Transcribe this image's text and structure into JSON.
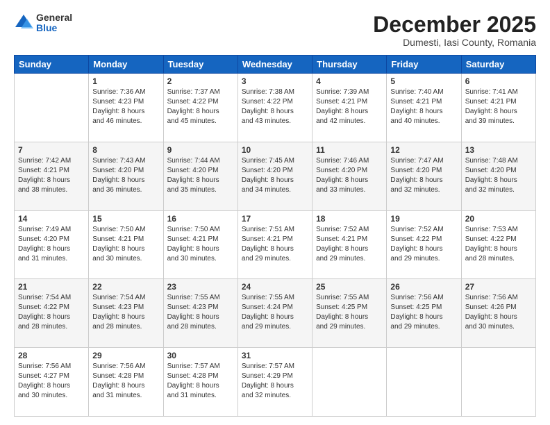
{
  "header": {
    "logo_general": "General",
    "logo_blue": "Blue",
    "month_title": "December 2025",
    "location": "Dumesti, Iasi County, Romania"
  },
  "days_of_week": [
    "Sunday",
    "Monday",
    "Tuesday",
    "Wednesday",
    "Thursday",
    "Friday",
    "Saturday"
  ],
  "weeks": [
    [
      {
        "day": "",
        "info": ""
      },
      {
        "day": "1",
        "info": "Sunrise: 7:36 AM\nSunset: 4:23 PM\nDaylight: 8 hours\nand 46 minutes."
      },
      {
        "day": "2",
        "info": "Sunrise: 7:37 AM\nSunset: 4:22 PM\nDaylight: 8 hours\nand 45 minutes."
      },
      {
        "day": "3",
        "info": "Sunrise: 7:38 AM\nSunset: 4:22 PM\nDaylight: 8 hours\nand 43 minutes."
      },
      {
        "day": "4",
        "info": "Sunrise: 7:39 AM\nSunset: 4:21 PM\nDaylight: 8 hours\nand 42 minutes."
      },
      {
        "day": "5",
        "info": "Sunrise: 7:40 AM\nSunset: 4:21 PM\nDaylight: 8 hours\nand 40 minutes."
      },
      {
        "day": "6",
        "info": "Sunrise: 7:41 AM\nSunset: 4:21 PM\nDaylight: 8 hours\nand 39 minutes."
      }
    ],
    [
      {
        "day": "7",
        "info": "Sunrise: 7:42 AM\nSunset: 4:21 PM\nDaylight: 8 hours\nand 38 minutes."
      },
      {
        "day": "8",
        "info": "Sunrise: 7:43 AM\nSunset: 4:20 PM\nDaylight: 8 hours\nand 36 minutes."
      },
      {
        "day": "9",
        "info": "Sunrise: 7:44 AM\nSunset: 4:20 PM\nDaylight: 8 hours\nand 35 minutes."
      },
      {
        "day": "10",
        "info": "Sunrise: 7:45 AM\nSunset: 4:20 PM\nDaylight: 8 hours\nand 34 minutes."
      },
      {
        "day": "11",
        "info": "Sunrise: 7:46 AM\nSunset: 4:20 PM\nDaylight: 8 hours\nand 33 minutes."
      },
      {
        "day": "12",
        "info": "Sunrise: 7:47 AM\nSunset: 4:20 PM\nDaylight: 8 hours\nand 32 minutes."
      },
      {
        "day": "13",
        "info": "Sunrise: 7:48 AM\nSunset: 4:20 PM\nDaylight: 8 hours\nand 32 minutes."
      }
    ],
    [
      {
        "day": "14",
        "info": "Sunrise: 7:49 AM\nSunset: 4:20 PM\nDaylight: 8 hours\nand 31 minutes."
      },
      {
        "day": "15",
        "info": "Sunrise: 7:50 AM\nSunset: 4:21 PM\nDaylight: 8 hours\nand 30 minutes."
      },
      {
        "day": "16",
        "info": "Sunrise: 7:50 AM\nSunset: 4:21 PM\nDaylight: 8 hours\nand 30 minutes."
      },
      {
        "day": "17",
        "info": "Sunrise: 7:51 AM\nSunset: 4:21 PM\nDaylight: 8 hours\nand 29 minutes."
      },
      {
        "day": "18",
        "info": "Sunrise: 7:52 AM\nSunset: 4:21 PM\nDaylight: 8 hours\nand 29 minutes."
      },
      {
        "day": "19",
        "info": "Sunrise: 7:52 AM\nSunset: 4:22 PM\nDaylight: 8 hours\nand 29 minutes."
      },
      {
        "day": "20",
        "info": "Sunrise: 7:53 AM\nSunset: 4:22 PM\nDaylight: 8 hours\nand 28 minutes."
      }
    ],
    [
      {
        "day": "21",
        "info": "Sunrise: 7:54 AM\nSunset: 4:22 PM\nDaylight: 8 hours\nand 28 minutes."
      },
      {
        "day": "22",
        "info": "Sunrise: 7:54 AM\nSunset: 4:23 PM\nDaylight: 8 hours\nand 28 minutes."
      },
      {
        "day": "23",
        "info": "Sunrise: 7:55 AM\nSunset: 4:23 PM\nDaylight: 8 hours\nand 28 minutes."
      },
      {
        "day": "24",
        "info": "Sunrise: 7:55 AM\nSunset: 4:24 PM\nDaylight: 8 hours\nand 29 minutes."
      },
      {
        "day": "25",
        "info": "Sunrise: 7:55 AM\nSunset: 4:25 PM\nDaylight: 8 hours\nand 29 minutes."
      },
      {
        "day": "26",
        "info": "Sunrise: 7:56 AM\nSunset: 4:25 PM\nDaylight: 8 hours\nand 29 minutes."
      },
      {
        "day": "27",
        "info": "Sunrise: 7:56 AM\nSunset: 4:26 PM\nDaylight: 8 hours\nand 30 minutes."
      }
    ],
    [
      {
        "day": "28",
        "info": "Sunrise: 7:56 AM\nSunset: 4:27 PM\nDaylight: 8 hours\nand 30 minutes."
      },
      {
        "day": "29",
        "info": "Sunrise: 7:56 AM\nSunset: 4:28 PM\nDaylight: 8 hours\nand 31 minutes."
      },
      {
        "day": "30",
        "info": "Sunrise: 7:57 AM\nSunset: 4:28 PM\nDaylight: 8 hours\nand 31 minutes."
      },
      {
        "day": "31",
        "info": "Sunrise: 7:57 AM\nSunset: 4:29 PM\nDaylight: 8 hours\nand 32 minutes."
      },
      {
        "day": "",
        "info": ""
      },
      {
        "day": "",
        "info": ""
      },
      {
        "day": "",
        "info": ""
      }
    ]
  ]
}
